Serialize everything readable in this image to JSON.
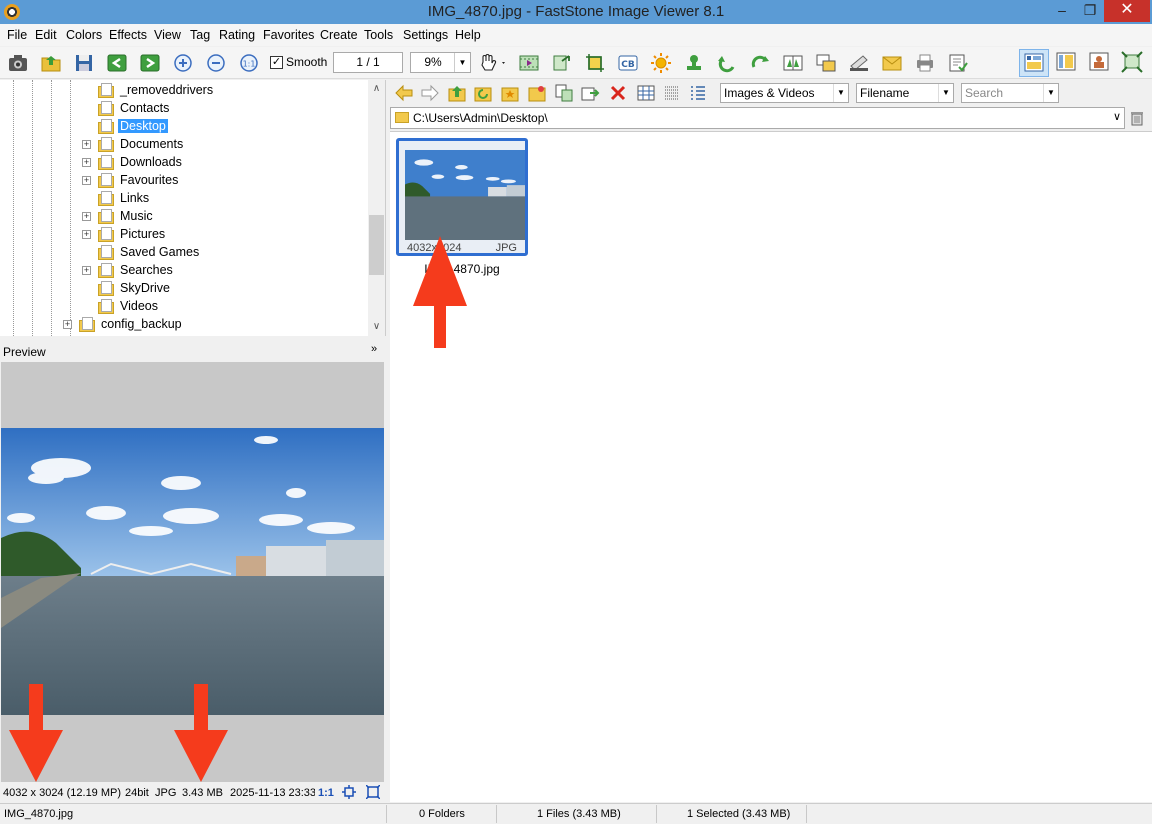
{
  "window": {
    "title": "IMG_4870.jpg  -  FastStone Image Viewer 8.1",
    "minimize": "–",
    "maximize": "❐",
    "close": "✕"
  },
  "menu": [
    "File",
    "Edit",
    "Colors",
    "Effects",
    "View",
    "Tag",
    "Rating",
    "Favorites",
    "Create",
    "Tools",
    "Settings",
    "Help"
  ],
  "toolbar": {
    "smooth_label": "Smooth",
    "smooth_checked": "✓",
    "page": "1 / 1",
    "zoom": "9%",
    "zoom_arrow": "▼"
  },
  "tree": {
    "expander": "+",
    "items": [
      {
        "label": "_removeddrivers",
        "expandable": false
      },
      {
        "label": "Contacts",
        "expandable": false
      },
      {
        "label": "Desktop",
        "expandable": false,
        "selected": true
      },
      {
        "label": "Documents",
        "expandable": true
      },
      {
        "label": "Downloads",
        "expandable": true
      },
      {
        "label": "Favourites",
        "expandable": true
      },
      {
        "label": "Links",
        "expandable": false
      },
      {
        "label": "Music",
        "expandable": true
      },
      {
        "label": "Pictures",
        "expandable": true
      },
      {
        "label": "Saved Games",
        "expandable": false
      },
      {
        "label": "Searches",
        "expandable": true
      },
      {
        "label": "SkyDrive",
        "expandable": false
      },
      {
        "label": "Videos",
        "expandable": false
      },
      {
        "label": "config_backup",
        "expandable": true
      }
    ],
    "scroll_up": "∧",
    "scroll_down": "∨"
  },
  "preview": {
    "label": "Preview",
    "collapse": "»",
    "dimensions": "4032 x 3024 (12.19 MP)",
    "bitdepth": "24bit",
    "format": "JPG",
    "size": "3.43 MB",
    "date": "2025-11-13 23:33",
    "ratio": "1:1"
  },
  "browser": {
    "filter": "Images & Videos",
    "sort": "Filename",
    "search_placeholder": "Search",
    "combo_arrow": "▼",
    "path": "C:\\Users\\Admin\\Desktop\\",
    "path_arrow": "∨",
    "thumbnail": {
      "name": "IMG_4870.jpg",
      "dimensions": "4032x3024",
      "type": "JPG"
    }
  },
  "status": {
    "file": "IMG_4870.jpg",
    "folders": "0 Folders",
    "files": "1 Files (3.43 MB)",
    "selected": "1 Selected (3.43 MB)"
  },
  "colors": {
    "titlebar": "#5b9bd5",
    "selection": "#3399ff",
    "thumb_border": "#2f6ed1",
    "annotation_arrow": "#f53b1c"
  }
}
